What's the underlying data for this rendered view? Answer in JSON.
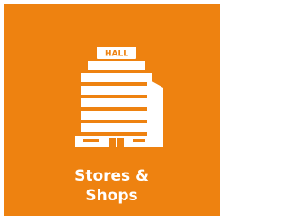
{
  "tile": {
    "label_line1": "Stores &",
    "label_line2": "Shops",
    "sign_text": "HALL",
    "icon": "mall-building-icon",
    "background_color": "#EE8210",
    "foreground_color": "#FFFFFF"
  }
}
